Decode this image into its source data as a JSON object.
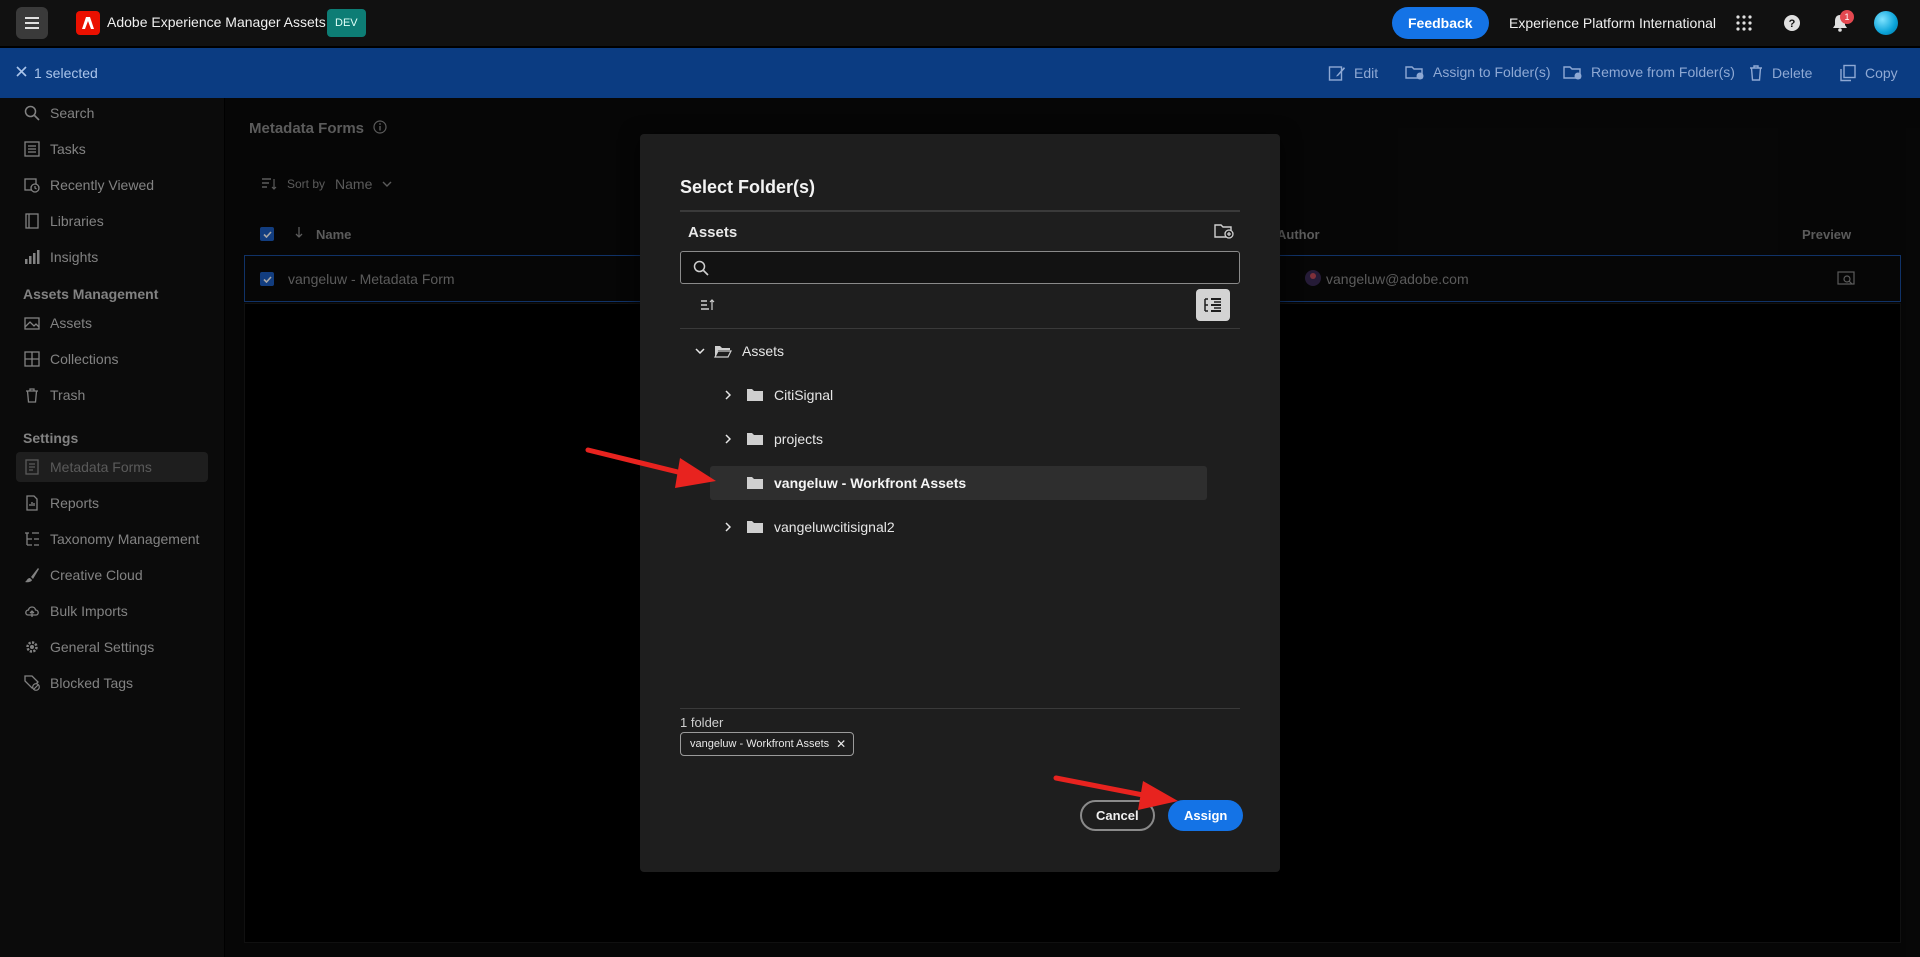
{
  "topbar": {
    "app_title": "Adobe Experience Manager Assets",
    "env_badge": "DEV",
    "feedback_label": "Feedback",
    "org_name": "Experience Platform International",
    "notification_count": "1"
  },
  "selection_bar": {
    "count": "1 selected",
    "actions": [
      "Edit",
      "Assign to Folder(s)",
      "Remove from Folder(s)",
      "Delete",
      "Copy"
    ]
  },
  "sidebar": {
    "items_top": [
      "Search",
      "Tasks",
      "Recently Viewed",
      "Libraries",
      "Insights"
    ],
    "section_assets": "Assets Management",
    "items_assets": [
      "Assets",
      "Collections",
      "Trash"
    ],
    "section_settings": "Settings",
    "items_settings": [
      "Metadata Forms",
      "Reports",
      "Taxonomy Management",
      "Creative Cloud",
      "Bulk Imports",
      "General Settings",
      "Blocked Tags"
    ]
  },
  "main": {
    "page_title": "Metadata Forms",
    "sort_label": "Sort by",
    "sort_value": "Name",
    "columns": [
      "Name",
      "Author",
      "Preview"
    ],
    "row": {
      "name": "vangeluw - Metadata Form",
      "author": "vangeluw@adobe.com"
    }
  },
  "dialog": {
    "title": "Select Folder(s)",
    "browser_title": "Assets",
    "search_value": "",
    "tree": {
      "root": "Assets",
      "children": [
        "CitiSignal",
        "projects",
        "vangeluw - Workfront Assets",
        "vangeluwcitisignal2"
      ]
    },
    "selected_count": "1 folder",
    "selected_chip": "vangeluw - Workfront Assets",
    "cancel_label": "Cancel",
    "assign_label": "Assign"
  },
  "colors": {
    "accent": "#1473e6",
    "selection_bar": "#0b3c82",
    "annotation_arrow": "#e8231f"
  }
}
